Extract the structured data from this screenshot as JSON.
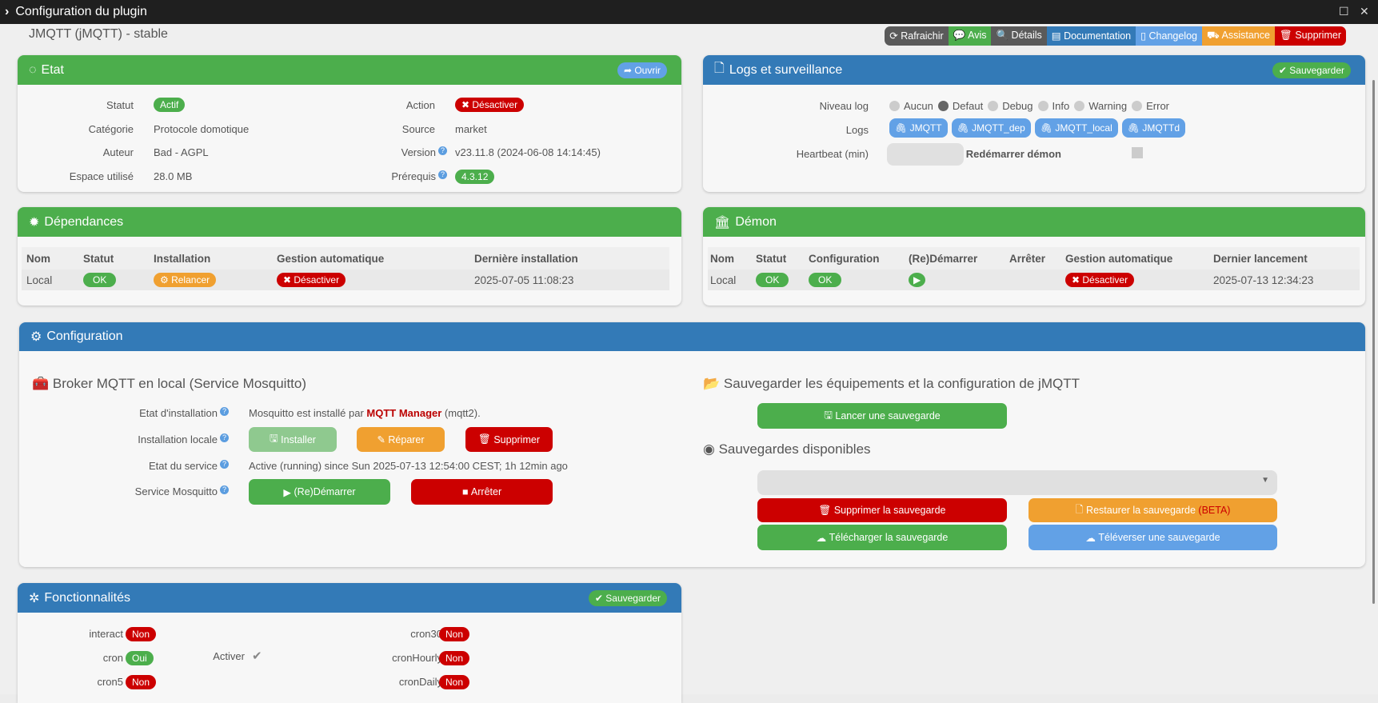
{
  "window": {
    "title": "Configuration du plugin"
  },
  "page_title": "JMQTT (jMQTT) - stable",
  "toolbar": [
    {
      "label": "Rafraichir",
      "icon": "⟳",
      "color": "#5a5a5a"
    },
    {
      "label": "Avis",
      "icon": "💬",
      "color": "#4cae4c"
    },
    {
      "label": "Détails",
      "icon": "🔍",
      "color": "#5a5a5a"
    },
    {
      "label": "Documentation",
      "icon": "▤",
      "color": "#337ab7"
    },
    {
      "label": "Changelog",
      "icon": "▯",
      "color": "#62a1e6"
    },
    {
      "label": "Assistance",
      "icon": "⛟",
      "color": "#f0a030"
    },
    {
      "label": "Supprimer",
      "icon": "🗑",
      "color": "#c00"
    }
  ],
  "etat": {
    "title": "Etat",
    "open": "Ouvrir",
    "statut_label": "Statut",
    "statut": "Actif",
    "categorie_label": "Catégorie",
    "categorie": "Protocole domotique",
    "auteur_label": "Auteur",
    "auteur": "Bad - AGPL",
    "espace_label": "Espace utilisé",
    "espace": "28.0 MB",
    "action_label": "Action",
    "action": "Désactiver",
    "source_label": "Source",
    "source": "market",
    "version_label": "Version",
    "version": "v23.11.8 (2024-06-08 14:14:45)",
    "prerequis_label": "Prérequis",
    "prerequis": "4.3.12"
  },
  "logs": {
    "title": "Logs et surveillance",
    "save": "Sauvegarder",
    "niveau_label": "Niveau log",
    "levels": [
      "Aucun",
      "Defaut",
      "Debug",
      "Info",
      "Warning",
      "Error"
    ],
    "selected_level": "Defaut",
    "logs_label": "Logs",
    "files": [
      "JMQTT",
      "JMQTT_dep",
      "JMQTT_local",
      "JMQTTd"
    ],
    "heartbeat_label": "Heartbeat (min)",
    "restart_label": "Redémarrer démon"
  },
  "deps": {
    "title": "Dépendances",
    "headers": [
      "Nom",
      "Statut",
      "Installation",
      "Gestion automatique",
      "Dernière installation"
    ],
    "row": {
      "nom": "Local",
      "statut": "OK",
      "installation": "Relancer",
      "gestion": "Désactiver",
      "date": "2025-07-05 11:08:23"
    }
  },
  "demon": {
    "title": "Démon",
    "headers": [
      "Nom",
      "Statut",
      "Configuration",
      "(Re)Démarrer",
      "Arrêter",
      "Gestion automatique",
      "Dernier lancement"
    ],
    "row": {
      "nom": "Local",
      "statut": "OK",
      "configuration": "OK",
      "gestion": "Désactiver",
      "date": "2025-07-13 12:34:23"
    }
  },
  "config": {
    "title": "Configuration",
    "broker_title": "Broker MQTT en local (Service Mosquitto)",
    "etat_install_label": "Etat d'installation",
    "etat_install_pre": "Mosquitto est installé par ",
    "etat_install_link": "MQTT Manager",
    "etat_install_post": " (mqtt2).",
    "install_locale_label": "Installation locale",
    "btn_installer": "Installer",
    "btn_reparer": "Réparer",
    "btn_supprimer": "Supprimer",
    "etat_service_label": "Etat du service",
    "etat_service": "Active (running) since Sun 2025-07-13 12:54:00 CEST; 1h 12min ago",
    "service_label": "Service Mosquitto",
    "btn_redemarrer": "(Re)Démarrer",
    "btn_arreter": "Arrêter",
    "backup_title": "Sauvegarder les équipements et la configuration de jMQTT",
    "btn_lancer": "Lancer une sauvegarde",
    "dispo_title": "Sauvegardes disponibles",
    "select_value": "",
    "btn_suppr_save": "Supprimer la sauvegarde",
    "btn_restore": "Restaurer la sauvegarde",
    "restore_beta": "(BETA)",
    "btn_download": "Télécharger la sauvegarde",
    "btn_upload": "Téléverser une sauvegarde"
  },
  "fonc": {
    "title": "Fonctionnalités",
    "save": "Sauvegarder",
    "activer": "Activer",
    "left": [
      {
        "name": "interact",
        "value": "Non"
      },
      {
        "name": "cron",
        "value": "Oui"
      },
      {
        "name": "cron5",
        "value": "Non"
      }
    ],
    "right": [
      {
        "name": "cron30",
        "value": "Non"
      },
      {
        "name": "cronHourly",
        "value": "Non"
      },
      {
        "name": "cronDaily",
        "value": "Non"
      }
    ]
  }
}
